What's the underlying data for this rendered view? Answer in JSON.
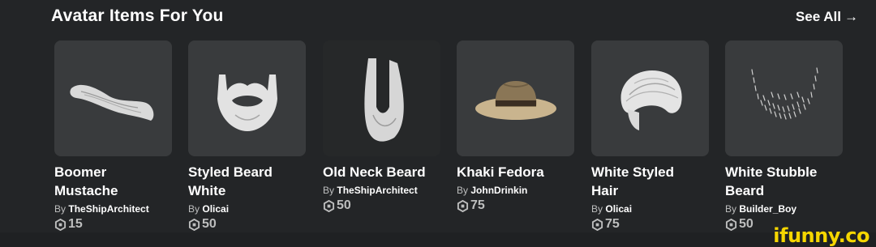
{
  "section": {
    "title": "Avatar Items For You",
    "see_all": "See All",
    "see_all_icon": "arrow-right-icon"
  },
  "items": [
    {
      "name_line1": "Boomer",
      "name_line2": "Mustache",
      "by": "By",
      "creator": "TheShipArchitect",
      "price": "15",
      "thumb_icon": "mustache-icon"
    },
    {
      "name_line1": "Styled Beard",
      "name_line2": "White",
      "by": "By",
      "creator": "Olicai",
      "price": "50",
      "thumb_icon": "beard-icon"
    },
    {
      "name_line1": "Old Neck Beard",
      "name_line2": "",
      "by": "By",
      "creator": "TheShipArchitect",
      "price": "50",
      "thumb_icon": "neck-beard-icon"
    },
    {
      "name_line1": "Khaki Fedora",
      "name_line2": "",
      "by": "By",
      "creator": "JohnDrinkin",
      "price": "75",
      "thumb_icon": "fedora-icon"
    },
    {
      "name_line1": "White Styled",
      "name_line2": "Hair",
      "by": "By",
      "creator": "Olicai",
      "price": "75",
      "thumb_icon": "hair-icon"
    },
    {
      "name_line1": "White Stubble",
      "name_line2": "Beard",
      "by": "By",
      "creator": "Builder_Boy",
      "price": "50",
      "thumb_icon": "stubble-icon"
    }
  ],
  "currency_icon": "robux-icon",
  "watermark": "ifunny.co",
  "colors": {
    "background": "#232527",
    "card": "#393b3d",
    "text": "#ffffff",
    "muted": "#bdbebe",
    "watermark": "#f5d600"
  }
}
